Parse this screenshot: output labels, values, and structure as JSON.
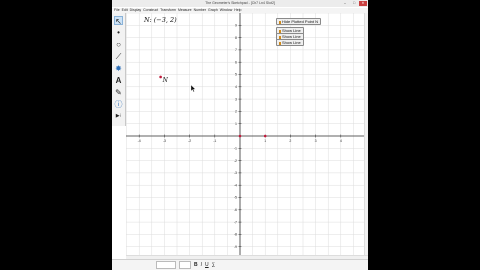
{
  "window": {
    "title": "The Geometer's Sketchpad - [Ch7 Ln4 Slot2]",
    "controls": {
      "minimize": "–",
      "maximize": "□",
      "close": "✕"
    }
  },
  "menu": [
    "File",
    "Edit",
    "Display",
    "Construct",
    "Transform",
    "Measure",
    "Number",
    "Graph",
    "Window",
    "Help"
  ],
  "tools": [
    {
      "name": "arrow-tool",
      "glyph": "↖",
      "selected": true
    },
    {
      "name": "point-tool",
      "glyph": "•"
    },
    {
      "name": "compass-tool",
      "glyph": "○"
    },
    {
      "name": "straightedge-tool",
      "glyph": "⟋"
    },
    {
      "name": "polygon-tool",
      "glyph": "✸"
    },
    {
      "name": "text-tool",
      "glyph": "A"
    },
    {
      "name": "marker-tool",
      "glyph": "✎"
    },
    {
      "name": "information-tool",
      "glyph": "ⓘ"
    },
    {
      "name": "custom-tool",
      "glyph": "▶⁝"
    }
  ],
  "measurement": "N: (−3, 2)",
  "buttons": {
    "hide_plotted": "Hide Plotted Point N",
    "show_1": "Show Line",
    "show_2": "Show Line",
    "show_3": "Show Line"
  },
  "point": {
    "label": "N",
    "x": -3,
    "y": 2
  },
  "grid": {
    "xmin": -4,
    "xmax": 4,
    "ymin": -9,
    "ymax": 9,
    "x_ticks": [
      -4,
      -3,
      -2,
      -1,
      1,
      2,
      3,
      4
    ],
    "y_ticks": [
      -9,
      -8,
      -7,
      -6,
      -5,
      -4,
      -3,
      -2,
      -1,
      1,
      2,
      3,
      4,
      5,
      6,
      7,
      8,
      9
    ]
  },
  "status": {
    "font_box": "",
    "size_box": "",
    "bold": "B",
    "italic": "I",
    "underline": "U"
  },
  "colors": {
    "point": "#c0193a",
    "axis": "#333333",
    "grid": "#dcdcdc",
    "button_marker": "#d08a1a"
  }
}
